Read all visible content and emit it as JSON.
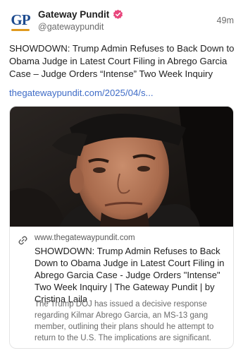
{
  "account": {
    "avatar_text": "GP",
    "display_name": "Gateway Pundit",
    "handle": "@gatewaypundit",
    "verified_color": "#e8467c"
  },
  "post": {
    "time_ago": "49m",
    "text": "SHOWDOWN: Trump Admin Refuses to Back Down to Obama Judge in Latest Court Filing in Abrego Garcia Case – Judge Orders “Intense” Two Week Inquiry",
    "link_text": "thegatewaypundit.com/2025/04/s..."
  },
  "link_card": {
    "domain": "www.thegatewaypundit.com",
    "title": "SHOWDOWN: Trump Admin Refuses to Back Down to Obama Judge in Latest Court Filing in Abrego Garcia Case - Judge Orders \"Intense\" Two Week Inquiry | The Gateway Pundit | by Cristina Laila",
    "description": "The Trump DOJ has issued a decisive response regarding Kilmar Abrego Garcia, an MS-13 gang member, outlining their plans should he attempt to return to the U.S. The implications are significant."
  },
  "colors": {
    "link": "#3f6cc7",
    "brand_blue": "#1c4a8e",
    "brand_gold": "#e09a1f"
  }
}
